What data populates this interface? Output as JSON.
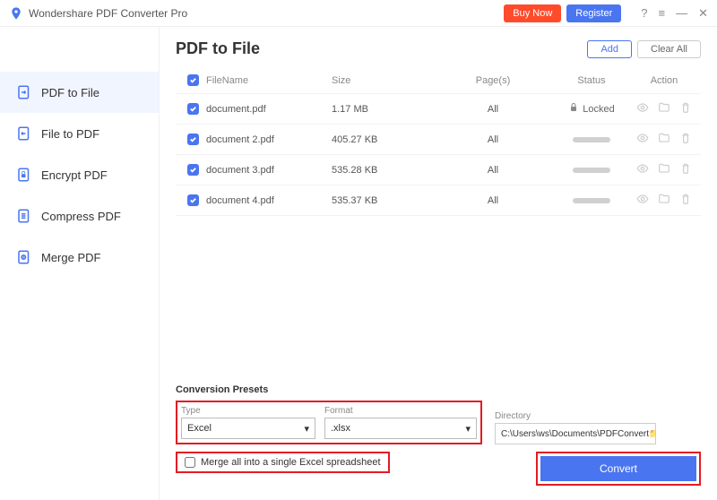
{
  "app": {
    "title": "Wondershare PDF Converter Pro"
  },
  "titlebar": {
    "buy": "Buy Now",
    "register": "Register"
  },
  "sidebar": {
    "items": [
      {
        "label": "PDF to File"
      },
      {
        "label": "File to PDF"
      },
      {
        "label": "Encrypt PDF"
      },
      {
        "label": "Compress PDF"
      },
      {
        "label": "Merge PDF"
      }
    ]
  },
  "page": {
    "title": "PDF to File",
    "add": "Add",
    "clear": "Clear All"
  },
  "table": {
    "headers": {
      "filename": "FileName",
      "size": "Size",
      "pages": "Page(s)",
      "status": "Status",
      "action": "Action"
    },
    "rows": [
      {
        "name": "document.pdf",
        "size": "1.17 MB",
        "pages": "All",
        "locked": true,
        "locked_label": "Locked"
      },
      {
        "name": "document 2.pdf",
        "size": "405.27 KB",
        "pages": "All",
        "locked": false
      },
      {
        "name": "document 3.pdf",
        "size": "535.28 KB",
        "pages": "All",
        "locked": false
      },
      {
        "name": "document 4.pdf",
        "size": "535.37 KB",
        "pages": "All",
        "locked": false
      }
    ]
  },
  "presets": {
    "section": "Conversion Presets",
    "type_label": "Type",
    "type_value": "Excel",
    "format_label": "Format",
    "format_value": ".xlsx",
    "dir_label": "Directory",
    "dir_value": "C:\\Users\\ws\\Documents\\PDFConvert",
    "merge_label": "Merge all into a single Excel spreadsheet",
    "convert": "Convert"
  }
}
